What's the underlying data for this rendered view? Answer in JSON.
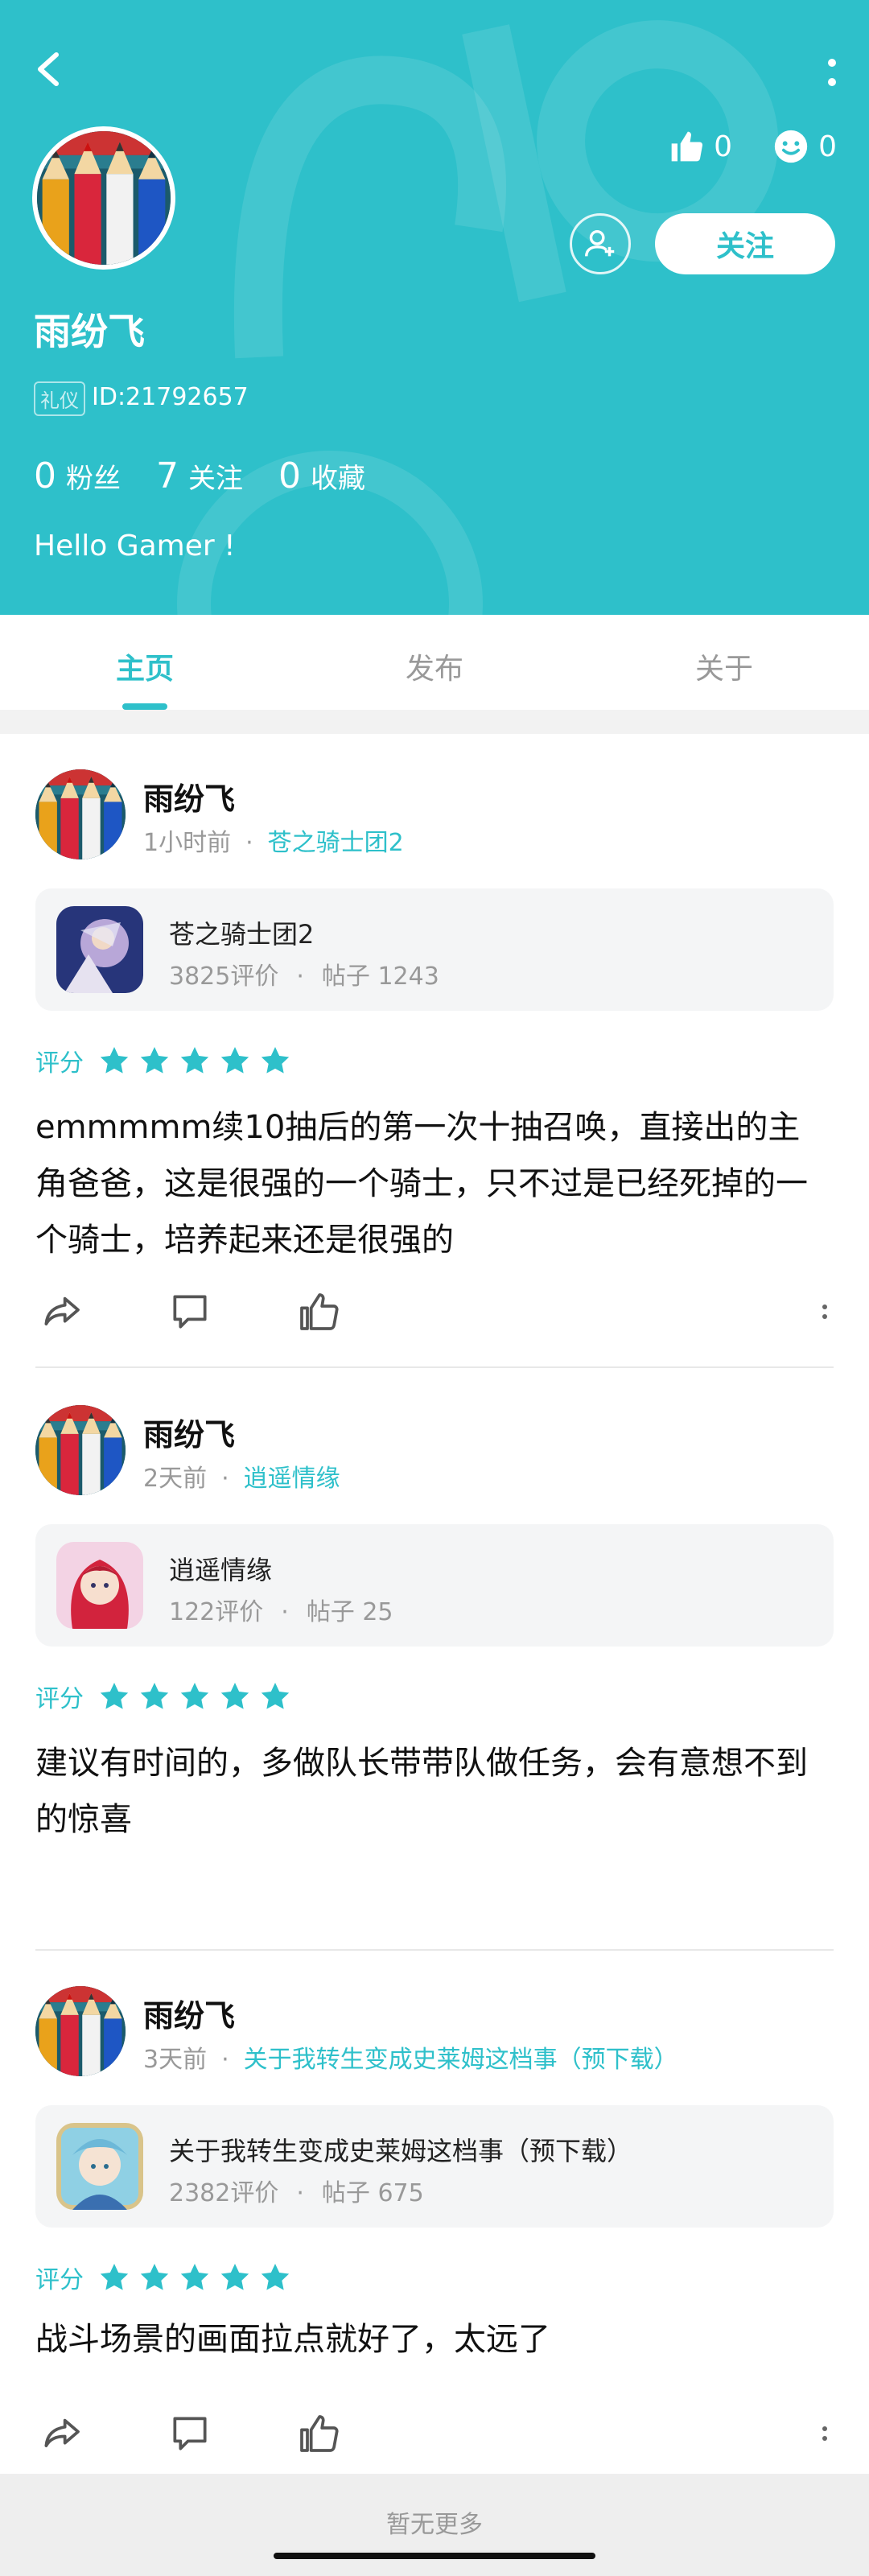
{
  "profile": {
    "name": "雨纷飞",
    "badge": "礼仪",
    "id_text": "ID:21792657",
    "likes": "0",
    "smiles": "0",
    "follow_label": "关注",
    "stats": {
      "fans_num": "0",
      "fans_label": "粉丝",
      "following_num": "7",
      "following_label": "关注",
      "fav_num": "0",
      "fav_label": "收藏"
    },
    "bio": "Hello Gamer !"
  },
  "tabs": [
    {
      "label": "主页",
      "active": true
    },
    {
      "label": "发布",
      "active": false
    },
    {
      "label": "关于",
      "active": false
    }
  ],
  "posts": [
    {
      "author": "雨纷飞",
      "time": "1小时前",
      "sep": "·",
      "game": "苍之骑士团2",
      "card": {
        "title": "苍之骑士团2",
        "reviews": "3825评价",
        "sep": "·",
        "posts": "帖子 1243"
      },
      "rating_label": "评分",
      "rating": 5,
      "text": "emmmmm续10抽后的第一次十抽召唤，直接出的主角爸爸，这是很强的一个骑士，只不过是已经死掉的一个骑士，培养起来还是很强的"
    },
    {
      "author": "雨纷飞",
      "time": "2天前",
      "sep": "·",
      "game": "逍遥情缘",
      "card": {
        "title": "逍遥情缘",
        "reviews": "122评价",
        "sep": "·",
        "posts": "帖子 25"
      },
      "rating_label": "评分",
      "rating": 5,
      "text": "建议有时间的，多做队长带带队做任务，会有意想不到的惊喜"
    },
    {
      "author": "雨纷飞",
      "time": "3天前",
      "sep": "·",
      "game": "关于我转生变成史莱姆这档事（预下载）",
      "card": {
        "title": "关于我转生变成史莱姆这档事（预下载）",
        "reviews": "2382评价",
        "sep": "·",
        "posts": "帖子 675"
      },
      "rating_label": "评分",
      "rating": 5,
      "text": "战斗场景的画面拉点就好了，太远了"
    }
  ],
  "footer": {
    "no_more": "暂无更多"
  },
  "colors": {
    "accent": "#2ec0ca"
  }
}
